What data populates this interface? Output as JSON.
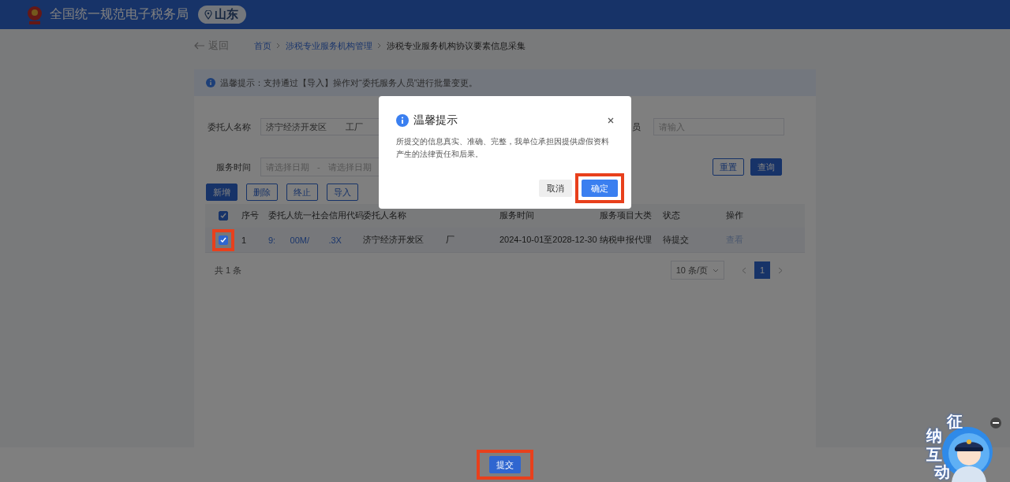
{
  "header": {
    "title": "全国统一规范电子税务局",
    "region": "山东"
  },
  "back": "返回",
  "breadcrumb": [
    {
      "label": "首页",
      "link": true
    },
    {
      "label": "涉税专业服务机构管理",
      "link": true
    },
    {
      "label": "涉税专业服务机构协议要素信息采集",
      "link": false
    }
  ],
  "notice": "温馨提示：支持通过【导入】操作对“委托服务人员”进行批量变更。",
  "filters": {
    "client_name": {
      "label": "委托人名称",
      "value": "济宁经济开发区        工厂"
    },
    "field_2": {
      "label": "员",
      "placeholder": "请输入"
    },
    "service_time": {
      "label": "服务时间",
      "start_placeholder": "请选择日期",
      "separator": "-",
      "end_placeholder": "请选择日期"
    },
    "buttons": [
      {
        "label": "重置",
        "primary": false
      },
      {
        "label": "查询",
        "primary": true
      }
    ]
  },
  "actions": [
    {
      "label": "新增",
      "primary": true
    },
    {
      "label": "删除",
      "primary": false
    },
    {
      "label": "终止",
      "primary": false
    },
    {
      "label": "导入",
      "primary": false
    }
  ],
  "table": {
    "all_checked": true,
    "columns": [
      "序号",
      "委托人统一社会信用代码",
      "委托人名称",
      "服务时间",
      "服务项目大类",
      "状态",
      "操作"
    ],
    "rows": [
      {
        "checked": true,
        "highlighted": true,
        "index": "1",
        "credit_code": "9:      00M/        .3X",
        "client_name": "济宁经济开发区         厂",
        "service_time": "2024-10-01至2028-12-30",
        "category": "纳税申报代理",
        "status": "待提交",
        "action": "查看"
      }
    ]
  },
  "footer": {
    "total": "共 1 条",
    "page_size": "10 条/页",
    "pages": [
      {
        "label": "1",
        "selected": true
      }
    ]
  },
  "dialog": {
    "title": "温馨提示",
    "message": "所提交的信息真实、准确、完整，我单位承担因提供虚假资料产生的法律责任和后果。",
    "buttons": [
      {
        "label": "取消",
        "primary": false,
        "highlighted": false
      },
      {
        "label": "确定",
        "primary": true,
        "highlighted": true
      }
    ]
  },
  "submit": {
    "label": "提交",
    "highlighted": true
  },
  "mascot": {
    "characters": [
      "征",
      "纳",
      "互",
      "动"
    ]
  }
}
